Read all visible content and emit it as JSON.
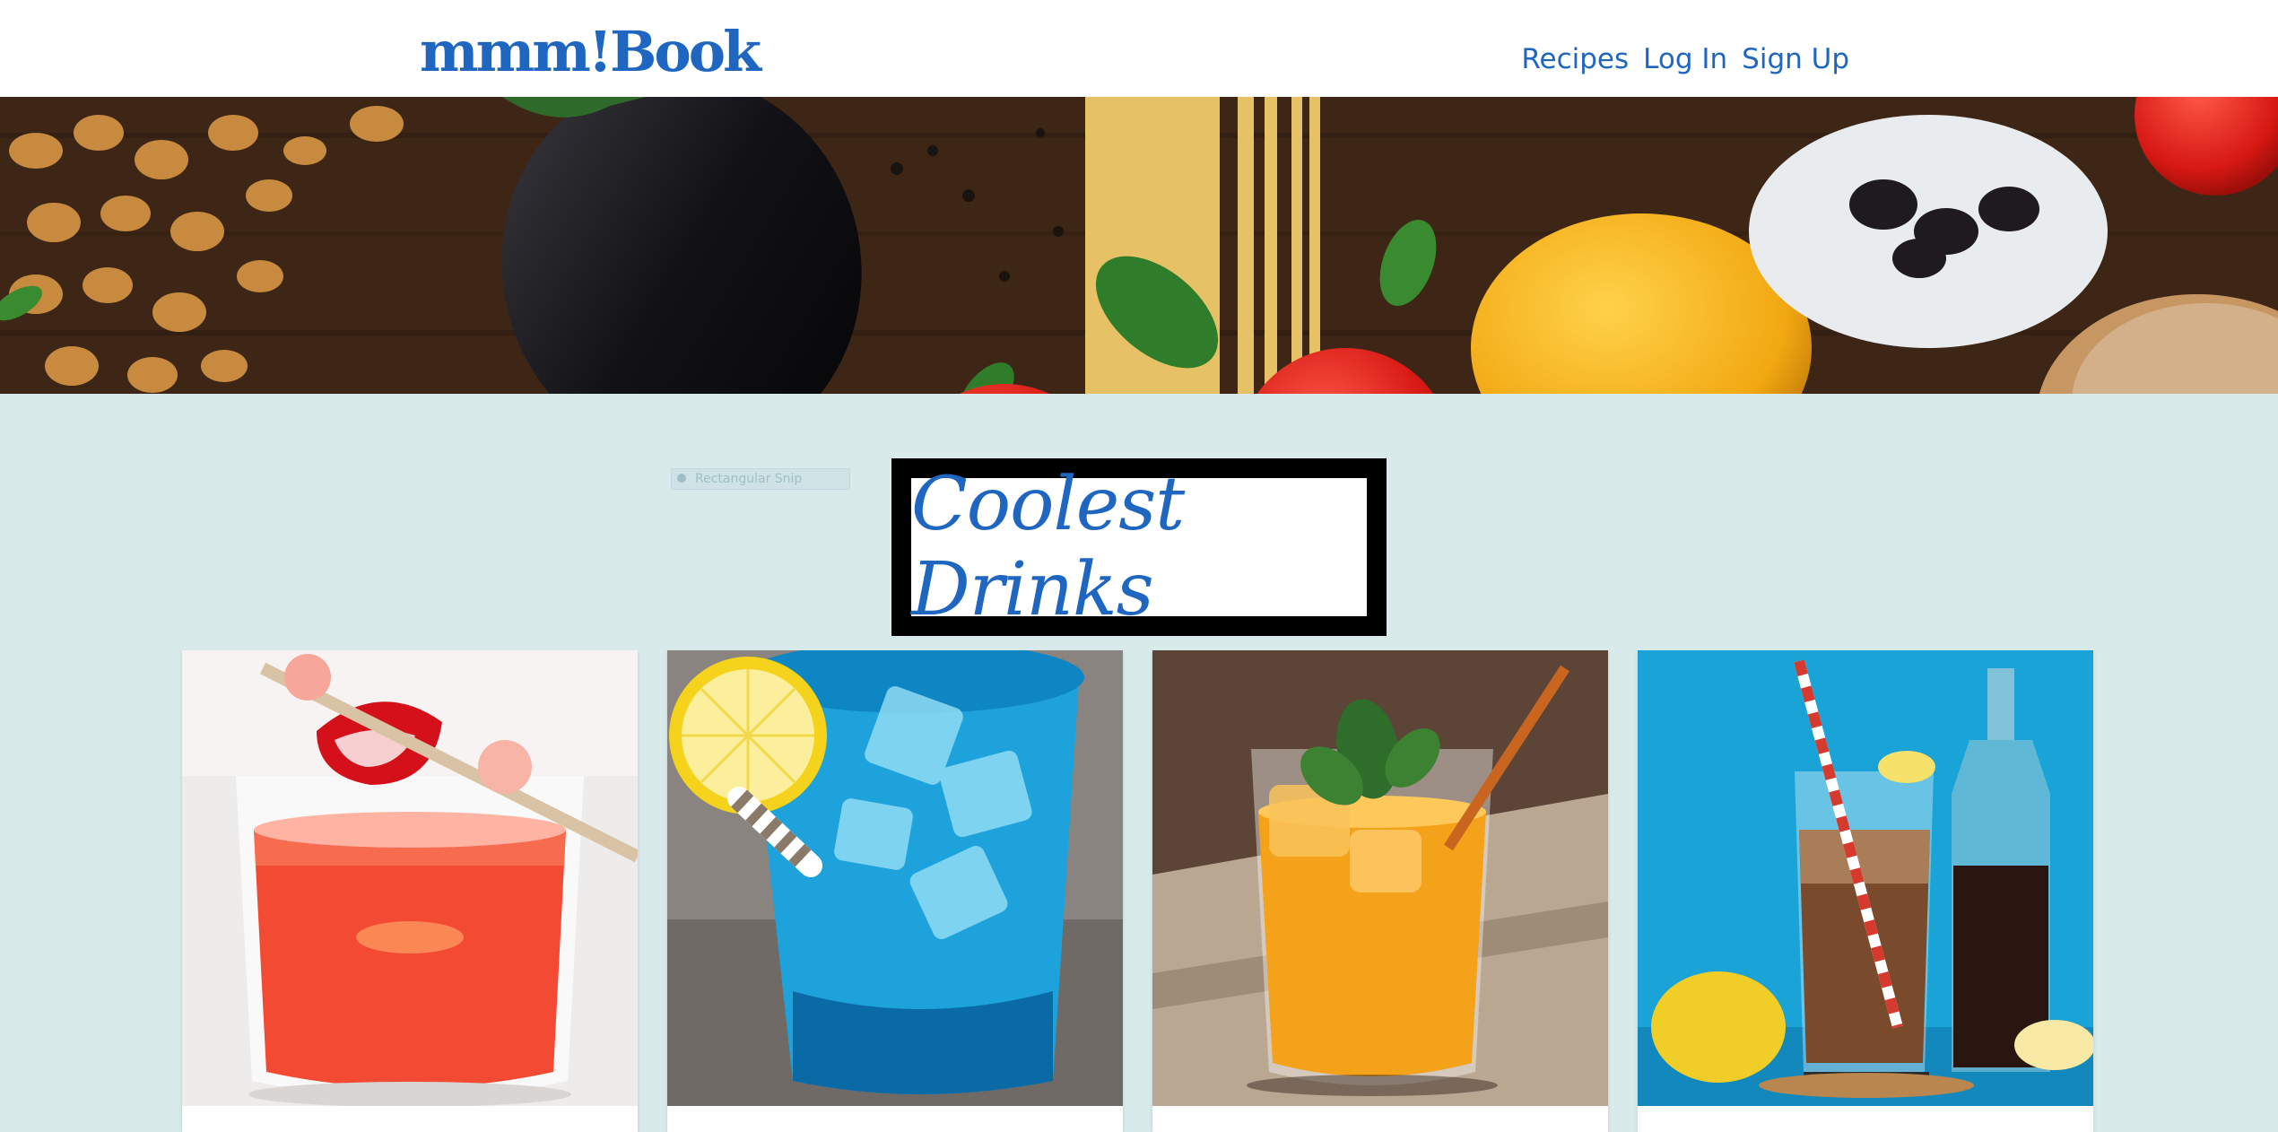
{
  "header": {
    "logo": "mmm!Book",
    "nav": [
      {
        "label": "Recipes"
      },
      {
        "label": "Log In"
      },
      {
        "label": "Sign Up"
      }
    ]
  },
  "hero": {
    "icon": "food-banner-image"
  },
  "ghost_label": "Rectangular Snip",
  "section": {
    "title": "Coolest Drinks"
  },
  "cards": [
    {
      "image": "strawberry-rhubarb-drink",
      "accent": "#f0442e"
    },
    {
      "image": "blue-lemonade-drink",
      "accent": "#1fa5d6"
    },
    {
      "image": "iced-tea-mint-drink",
      "accent": "#f4a21a"
    },
    {
      "image": "cola-lemon-drink",
      "accent": "#1aa3d6"
    }
  ],
  "colors": {
    "brand": "#1f66c1",
    "page_bg": "#d8eaea",
    "header_bg": "#ffffff"
  }
}
